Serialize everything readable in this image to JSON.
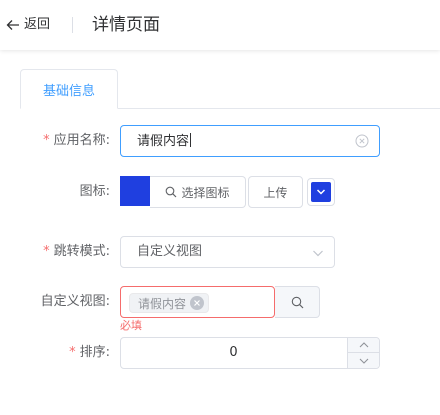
{
  "header": {
    "back_label": "返回",
    "title": "详情页面"
  },
  "tabs": [
    {
      "label": "基础信息",
      "active": true
    }
  ],
  "form": {
    "app_name": {
      "label": "应用名称:",
      "required": true,
      "value": "请假内容"
    },
    "icon": {
      "label": "图标:",
      "pick_label": "选择图标",
      "upload_label": "上传",
      "color": "#1f3fe0"
    },
    "jump_mode": {
      "label": "跳转模式:",
      "required": true,
      "value": "自定义视图"
    },
    "custom_view": {
      "label": "自定义视图:",
      "tag": "请假内容",
      "error": "必填"
    },
    "sort": {
      "label": "排序:",
      "required": true,
      "value": "0"
    }
  },
  "colors": {
    "primary": "#409eff",
    "danger": "#f56c6c",
    "icon_color": "#1f3fe0"
  }
}
